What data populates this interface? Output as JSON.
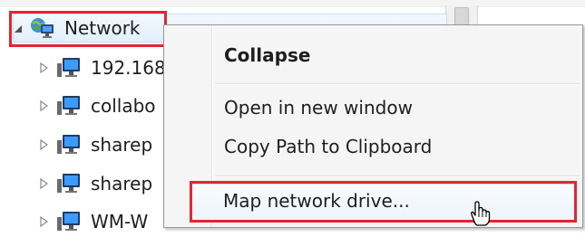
{
  "tree": {
    "network_label": "Network",
    "items": [
      {
        "label": "192.168"
      },
      {
        "label": "collabo"
      },
      {
        "label": "sharep"
      },
      {
        "label": "sharep"
      },
      {
        "label": "WM-W"
      }
    ]
  },
  "context_menu": {
    "items": [
      {
        "label": "Collapse"
      },
      {
        "label": "Open in new window"
      },
      {
        "label": "Copy Path to Clipboard"
      },
      {
        "label": "Map network drive..."
      }
    ]
  },
  "colors": {
    "highlight_box": "#e12630",
    "selection_bg": "#e2effb",
    "menu_bg": "#f5f5f5"
  },
  "icons": {
    "network": "network-icon",
    "computer": "computer-icon",
    "cursor": "hand-pointer-icon"
  }
}
